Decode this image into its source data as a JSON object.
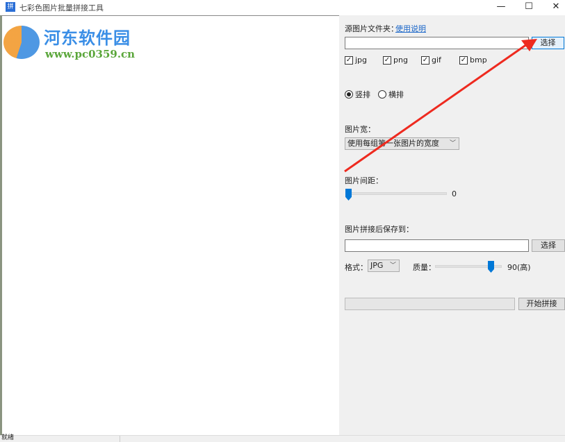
{
  "window": {
    "title": "七彩色图片批量拼接工具",
    "icon": "app-icon",
    "min": "—",
    "max": "☐",
    "close": "✕"
  },
  "watermark": {
    "name": "河东软件园",
    "url": "www.pc0359.cn"
  },
  "source": {
    "label": "源图片文件夹：",
    "help_link": "使用说明",
    "path": "",
    "browse": "选择"
  },
  "filetypes": [
    {
      "label": "jpg",
      "checked": true
    },
    {
      "label": "png",
      "checked": true
    },
    {
      "label": "gif",
      "checked": true
    },
    {
      "label": "bmp",
      "checked": true
    }
  ],
  "layout": {
    "vertical": "竖排",
    "horizontal": "横排",
    "selected": "vertical"
  },
  "width": {
    "label": "图片宽：",
    "selected": "使用每组第一张图片的宽度"
  },
  "spacing": {
    "label": "图片间距：",
    "value": "0",
    "fraction": 0
  },
  "output": {
    "label": "图片拼接后保存到：",
    "path": "",
    "browse": "选择"
  },
  "format": {
    "label": "格式：",
    "selected": "JPG"
  },
  "quality": {
    "label": "质量：",
    "value_text": "90(高)",
    "value": 90
  },
  "progress": {
    "fraction": 0
  },
  "start": "开始拼接",
  "status": "就绪",
  "colors": {
    "accent": "#0078d7",
    "arrow": "#ee2a1f"
  }
}
